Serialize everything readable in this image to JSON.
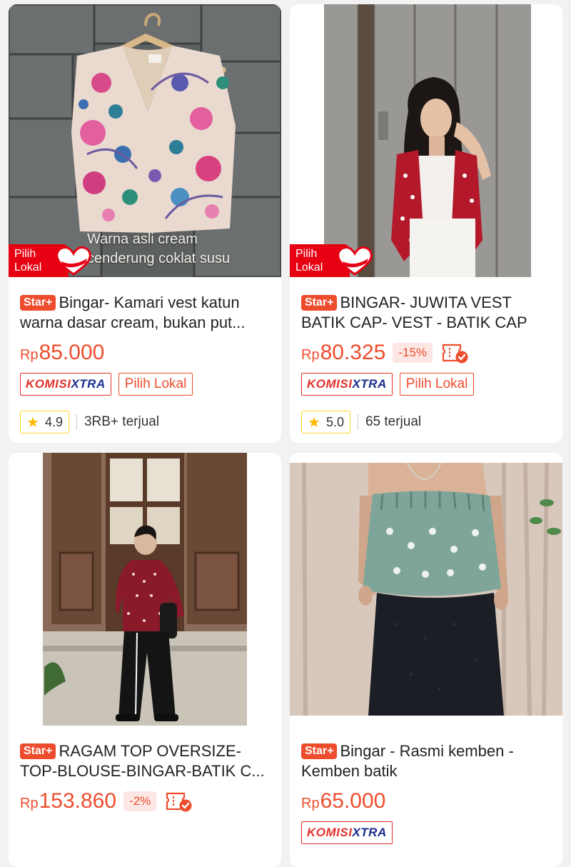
{
  "products": [
    {
      "photo_caption": [
        "Warna asli cream",
        "cenderung coklat susu"
      ],
      "pilih_lokal_badge": [
        "Pilih",
        "Lokal"
      ],
      "star_label": "Star+",
      "title": "Bingar- Kamari vest katun warna dasar cream, bukan put...",
      "price_currency": "Rp",
      "price_amount": "85.000",
      "komisi_a": "KOMISI",
      "komisi_b": "XTRA",
      "tag": "Pilih Lokal",
      "rating": "4.9",
      "sold": "3RB+ terjual"
    },
    {
      "pilih_lokal_badge": [
        "Pilih",
        "Lokal"
      ],
      "star_label": "Star+",
      "title": "BINGAR- JUWITA VEST BATIK CAP- VEST - BATIK CAP",
      "price_currency": "Rp",
      "price_amount": "80.325",
      "discount": "-15%",
      "komisi_a": "KOMISI",
      "komisi_b": "XTRA",
      "tag": "Pilih Lokal",
      "rating": "5.0",
      "sold": "65 terjual"
    },
    {
      "star_label": "Star+",
      "title": "RAGAM TOP OVERSIZE-TOP-BLOUSE-BINGAR-BATIK C...",
      "price_currency": "Rp",
      "price_amount": "153.860",
      "discount": "-2%"
    },
    {
      "star_label": "Star+",
      "title": "Bingar - Rasmi kemben - Kemben batik",
      "price_currency": "Rp",
      "price_amount": "65.000",
      "komisi_a": "KOMISI",
      "komisi_b": "XTRA"
    }
  ],
  "icons": {
    "rating": "star-icon",
    "coupon": "cod-coupon-icon",
    "badge": "pilih-lokal-heart-icon"
  },
  "colors": {
    "accent": "#ee4d2d",
    "komisi_red": "#e3322a",
    "komisi_blue": "#1b2d8f",
    "rating_border": "#ffd42a",
    "pilih_lokal_red": "#e60012"
  }
}
